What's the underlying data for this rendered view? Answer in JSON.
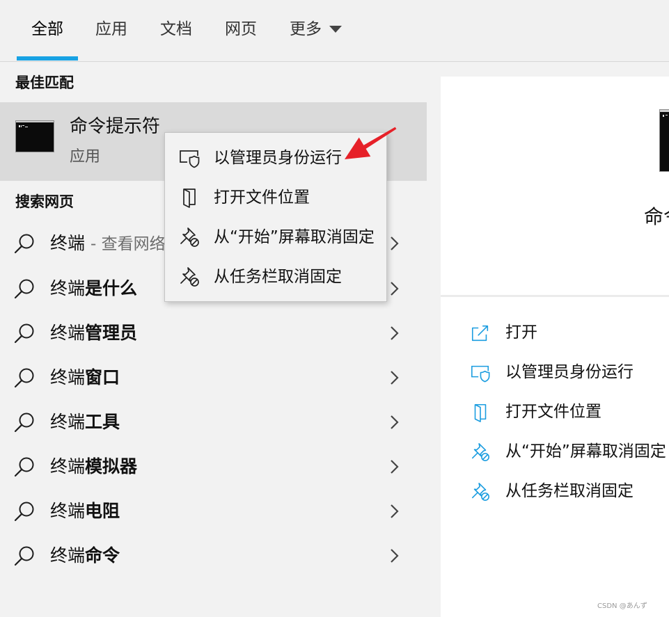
{
  "tabs": [
    {
      "label": "全部",
      "selected": true
    },
    {
      "label": "应用",
      "selected": false
    },
    {
      "label": "文档",
      "selected": false
    },
    {
      "label": "网页",
      "selected": false
    },
    {
      "label": "更多",
      "selected": false,
      "icon": "caret-down-icon"
    }
  ],
  "best_match": {
    "header": "最佳匹配",
    "title": "命令提示符",
    "subtitle": "应用",
    "icon": "command-prompt-icon"
  },
  "web_search": {
    "header": "搜索网页",
    "items": [
      {
        "query": "终端",
        "suffix": "- 查看网络",
        "icon": "search-icon"
      },
      {
        "query": "终端",
        "suffix": "是什么",
        "icon": "search-icon"
      },
      {
        "query": "终端",
        "suffix": "管理员",
        "icon": "search-icon"
      },
      {
        "query": "终端",
        "suffix": "窗口",
        "icon": "search-icon"
      },
      {
        "query": "终端",
        "suffix": "工具",
        "icon": "search-icon"
      },
      {
        "query": "终端",
        "suffix": "模拟器",
        "icon": "search-icon"
      },
      {
        "query": "终端",
        "suffix": "电阻",
        "icon": "search-icon"
      },
      {
        "query": "终端",
        "suffix": "命令",
        "icon": "search-icon"
      }
    ]
  },
  "context_menu": {
    "items": [
      {
        "label": "以管理员身份运行",
        "icon": "shield-icon"
      },
      {
        "label": "打开文件位置",
        "icon": "file-location-icon"
      },
      {
        "label": "从“开始”屏幕取消固定",
        "icon": "unpin-icon"
      },
      {
        "label": "从任务栏取消固定",
        "icon": "unpin-icon"
      }
    ]
  },
  "preview": {
    "title": "命令",
    "icon": "command-prompt-icon",
    "actions": [
      {
        "label": "打开",
        "icon": "open-icon"
      },
      {
        "label": "以管理员身份运行",
        "icon": "shield-icon"
      },
      {
        "label": "打开文件位置",
        "icon": "file-location-icon"
      },
      {
        "label": "从“开始”屏幕取消固定",
        "icon": "unpin-icon"
      },
      {
        "label": "从任务栏取消固定",
        "icon": "unpin-icon"
      }
    ]
  },
  "annotation": {
    "icon": "red-arrow-icon"
  },
  "watermark": "CSDN @あんず",
  "colors": {
    "accent": "#18a2e4",
    "highlight": "#dadada",
    "annotation_arrow": "#e62129",
    "action_icon": "#1b9de0"
  }
}
